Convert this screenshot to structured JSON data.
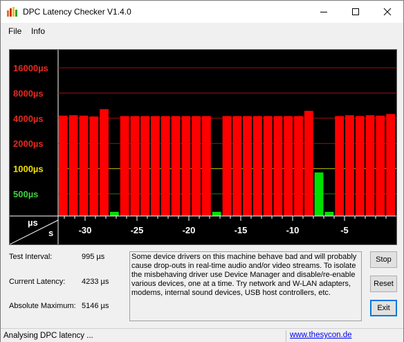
{
  "window": {
    "title": "DPC Latency Checker V1.4.0"
  },
  "menu": [
    "File",
    "Info"
  ],
  "chart_data": {
    "type": "bar",
    "y_scale": "log",
    "y_ticks": [
      "16000µs",
      "8000µs",
      "4000µs",
      "2000µs",
      "1000µs",
      "500µs"
    ],
    "y_tick_values": [
      16000,
      8000,
      4000,
      2000,
      1000,
      500
    ],
    "y_tick_colors": [
      "#e8281e",
      "#e8281e",
      "#e8281e",
      "#e8281e",
      "#f0e000",
      "#40d040"
    ],
    "x_ticks": [
      "-30",
      "-25",
      "-20",
      "-15",
      "-10",
      "-5"
    ],
    "x_tick_values": [
      -30,
      -25,
      -20,
      -15,
      -10,
      -5
    ],
    "corner_top": "µs",
    "corner_bottom": "s",
    "x": [
      -32,
      -31,
      -30,
      -29,
      -28,
      -27,
      -26,
      -25,
      -24,
      -23,
      -22,
      -21,
      -20,
      -19,
      -18,
      -17,
      -16,
      -15,
      -14,
      -13,
      -12,
      -11,
      -10,
      -9,
      -8,
      -7,
      -6,
      -5,
      -4,
      -3,
      -2,
      -1,
      0
    ],
    "values": [
      4300,
      4350,
      4300,
      4200,
      5146,
      350,
      4250,
      4250,
      4250,
      4250,
      4250,
      4250,
      4250,
      4250,
      4250,
      350,
      4250,
      4250,
      4250,
      4250,
      4250,
      4250,
      4250,
      4250,
      4900,
      900,
      350,
      4250,
      4350,
      4250,
      4350,
      4300,
      4500
    ],
    "colors": [
      "red",
      "red",
      "red",
      "red",
      "red",
      "green",
      "red",
      "red",
      "red",
      "red",
      "red",
      "red",
      "red",
      "red",
      "red",
      "green",
      "red",
      "red",
      "red",
      "red",
      "red",
      "red",
      "red",
      "red",
      "red",
      "green",
      "green",
      "red",
      "red",
      "red",
      "red",
      "red",
      "red"
    ],
    "palette": {
      "red": "#ff0000",
      "green": "#00e000",
      "grid_red": "#a01010",
      "grid_yellow": "#c0c000",
      "grid_green": "#108010"
    }
  },
  "info": {
    "test_interval_label": "Test Interval:",
    "test_interval_value": "995 µs",
    "current_latency_label": "Current Latency:",
    "current_latency_value": "4233 µs",
    "absolute_maximum_label": "Absolute Maximum:",
    "absolute_maximum_value": "5146 µs"
  },
  "message": "Some device drivers on this machine behave bad and will probably cause drop-outs in real-time audio and/or video streams. To isolate the misbehaving driver use Device Manager and disable/re-enable various devices, one at a time. Try network and W-LAN adapters, modems, internal sound devices, USB host controllers, etc.",
  "buttons": {
    "stop": "Stop",
    "reset": "Reset",
    "exit": "Exit"
  },
  "status": {
    "text": "Analysing DPC latency ...",
    "link": "www.thesycon.de"
  }
}
